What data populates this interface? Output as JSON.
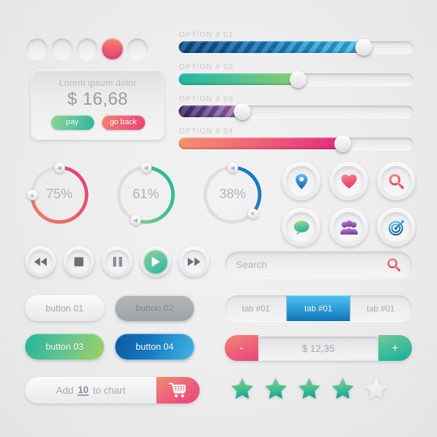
{
  "toggles": {
    "name": "radio-dot-group",
    "items": [
      {
        "label": "dot-1",
        "active": false
      },
      {
        "label": "dot-2",
        "active": false
      },
      {
        "label": "dot-3",
        "active": false
      },
      {
        "label": "dot-4",
        "active": true
      },
      {
        "label": "dot-5",
        "active": false
      }
    ],
    "active_color": "#ef5a78"
  },
  "card": {
    "title": "Lorem ipsum dolor",
    "price": "$ 16,68",
    "pay_label": "pay",
    "goback_label": "go back",
    "pay_color": "#2fb39a",
    "goback_color": "#e8466f"
  },
  "sliders": [
    {
      "label": "OPTION # 01",
      "value": 79,
      "color": "#1878be",
      "striped": true
    },
    {
      "label": "OPTION # 02",
      "value": 51,
      "color": "#4cc194",
      "striped": false
    },
    {
      "label": "OPTION # 03",
      "value": 27,
      "color": "#6c4f9e",
      "striped": true
    },
    {
      "label": "OPTION # 04",
      "value": 70,
      "color": "#ef6275",
      "striped": false
    }
  ],
  "circles": [
    {
      "label": "75%",
      "value": 75,
      "color": "#e0406d",
      "color2": "#f4816c"
    },
    {
      "label": "61%",
      "value": 61,
      "color": "#1db89a",
      "color2": "#8bcf84"
    },
    {
      "label": "38%",
      "value": 38,
      "color": "#0d6fc0",
      "color2": "#2f96d8"
    }
  ],
  "icon_buttons": [
    {
      "name": "location-pin-icon",
      "color": "#2e9bd8"
    },
    {
      "name": "heart-icon",
      "color": "#ee5c78"
    },
    {
      "name": "magnifier-icon",
      "color": "#ec6a62"
    },
    {
      "name": "speech-bubble-icon",
      "color": "#6ec48e"
    },
    {
      "name": "users-icon",
      "color": "#9b5fbe"
    },
    {
      "name": "target-icon",
      "color": "#2b8fd0"
    }
  ],
  "media": [
    {
      "name": "rewind-button",
      "glyph": "rewind"
    },
    {
      "name": "stop-button",
      "glyph": "stop"
    },
    {
      "name": "pause-button",
      "glyph": "pause"
    },
    {
      "name": "play-button",
      "glyph": "play"
    },
    {
      "name": "fast-forward-button",
      "glyph": "forward"
    }
  ],
  "search": {
    "placeholder": "Search",
    "value": "",
    "icon": "magnifier-icon",
    "icon_color": "#ea5a72"
  },
  "buttons": [
    {
      "label": "button 01",
      "style": "b1"
    },
    {
      "label": "button 02",
      "style": "b2"
    },
    {
      "label": "button 03",
      "style": "b3"
    },
    {
      "label": "button 04",
      "style": "b4"
    }
  ],
  "tabs": {
    "items": [
      {
        "label": "tab #01",
        "active": false
      },
      {
        "label": "tab #01",
        "active": true
      },
      {
        "label": "tab #01",
        "active": false
      }
    ],
    "active_color": "#2e9ed8"
  },
  "stepper": {
    "minus_label": "-",
    "plus_label": "+",
    "value": "$ 12,35",
    "minus_color": "#ee5f79",
    "plus_color": "#3dbc9c"
  },
  "add_to_chart": {
    "prefix": "Add",
    "quantity": "10",
    "suffix": "to chart",
    "cart_icon": "shopping-cart-icon",
    "cart_color": "#ee5f7b"
  },
  "rating": {
    "filled": 4,
    "total": 5,
    "filled_color": "#3fbd8e",
    "empty_color": "#f0f0f1"
  }
}
